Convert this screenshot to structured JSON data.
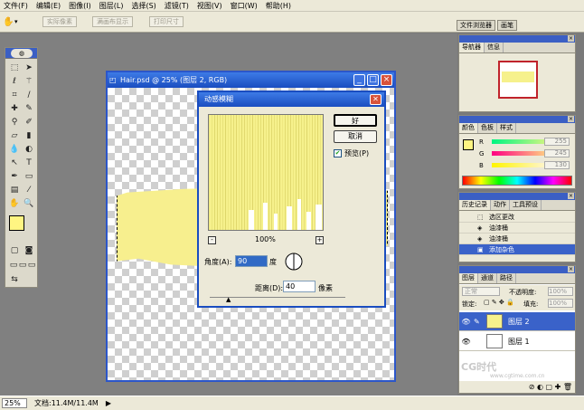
{
  "menu": {
    "items": [
      "文件(F)",
      "编辑(E)",
      "图像(I)",
      "图层(L)",
      "选择(S)",
      "滤镜(T)",
      "视图(V)",
      "窗口(W)",
      "帮助(H)"
    ]
  },
  "options": {
    "btn1": "实际像素",
    "btn2": "满画布显示",
    "btn3": "打印尺寸"
  },
  "wells": {
    "tab1": "文件浏览器",
    "tab2": "画笔"
  },
  "document": {
    "title": "Hair.psd @ 25% (图层 2, RGB)"
  },
  "dialog": {
    "title": "动感模糊",
    "ok": "好",
    "cancel": "取消",
    "preview_label": "预览(P)",
    "preview_checked": true,
    "zoom": "100%",
    "zoom_minus": "-",
    "zoom_plus": "+",
    "angle_label": "角度(A):",
    "angle_value": "90",
    "angle_unit": "度",
    "distance_label": "距离(D):",
    "distance_value": "40",
    "distance_unit": "像素"
  },
  "navigator": {
    "tab1": "导航器",
    "tab2": "信息"
  },
  "color_panel": {
    "tab1": "颜色",
    "tab2": "色板",
    "tab3": "样式",
    "r_label": "R",
    "g_label": "G",
    "b_label": "B",
    "r_value": "255",
    "g_value": "245",
    "b_value": "130",
    "fg_color": "#fff582"
  },
  "history": {
    "tab1": "历史记录",
    "tab2": "动作",
    "tab3": "工具预设",
    "items": [
      "选区更改",
      "油漆桶",
      "油漆桶",
      "添加杂色"
    ]
  },
  "layers": {
    "tab1": "图层",
    "tab2": "通道",
    "tab3": "路径",
    "blend_mode": "正常",
    "opacity_label": "不透明度:",
    "opacity_value": "100%",
    "lock_label": "锁定:",
    "fill_label": "填充:",
    "fill_value": "100%",
    "rows": [
      "图层 2",
      "图层 1"
    ]
  },
  "status": {
    "zoom": "25%",
    "doc": "文档:11.4M/11.4M"
  },
  "watermark": {
    "brand": "CG时代",
    "url": "www.cgtime.com.cn"
  },
  "colors": {
    "accent": "#3d7be6",
    "hair": "#f6f18c"
  }
}
